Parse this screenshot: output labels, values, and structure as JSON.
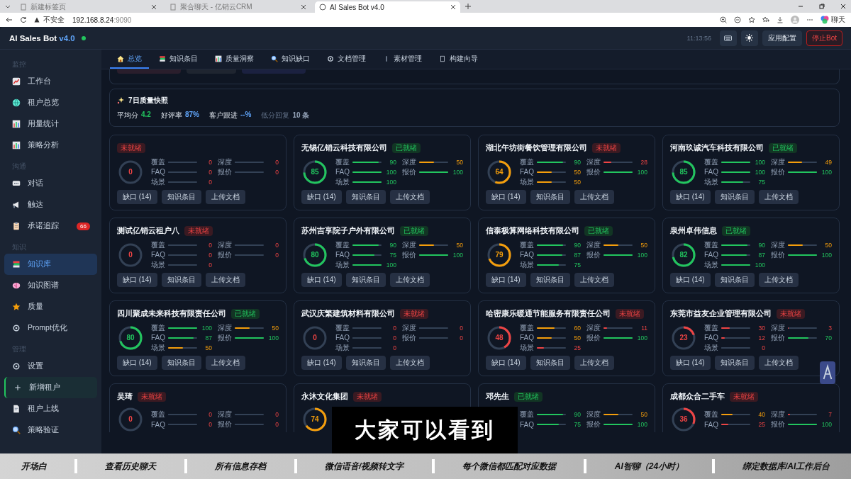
{
  "browser": {
    "tabs": [
      {
        "title": "新建标签页",
        "selected": false
      },
      {
        "title": "聚合聊天 - 亿销云CRM",
        "selected": false
      },
      {
        "title": "AI Sales Bot v4.0",
        "selected": true
      }
    ],
    "security": "不安全",
    "host": "192.168.8.24",
    "port": ":9090",
    "assistant": "聊天"
  },
  "app": {
    "title": "AI Sales Bot",
    "version": "v4.0",
    "online": true,
    "time": "11:13:56",
    "buttons": [
      {
        "label": "应用配置",
        "kind": "default"
      },
      {
        "label": "停止Bot",
        "kind": "danger"
      }
    ]
  },
  "sidebar": {
    "sections": [
      {
        "title": "监控",
        "items": [
          {
            "label": "工作台",
            "kind": "link",
            "selected": false
          },
          {
            "label": "租户总览",
            "kind": "link",
            "selected": false
          },
          {
            "label": "用量统计",
            "kind": "link",
            "selected": false
          },
          {
            "label": "策略分析",
            "kind": "link",
            "selected": false
          }
        ]
      },
      {
        "title": "沟通",
        "items": [
          {
            "label": "对话",
            "kind": "link",
            "selected": false
          },
          {
            "label": "触达",
            "kind": "link",
            "selected": false
          },
          {
            "label": "承诺追踪",
            "kind": "link",
            "selected": false,
            "badge": "66"
          }
        ]
      },
      {
        "title": "知识",
        "items": [
          {
            "label": "知识库",
            "kind": "link",
            "selected": true
          },
          {
            "label": "知识图谱",
            "kind": "link",
            "selected": false
          },
          {
            "label": "质量",
            "kind": "link",
            "selected": false
          },
          {
            "label": "Prompt优化",
            "kind": "link",
            "selected": false
          }
        ]
      },
      {
        "title": "管理",
        "items": [
          {
            "label": "设置",
            "kind": "link",
            "selected": false
          },
          {
            "label": "新增租户",
            "kind": "action",
            "selected": false
          },
          {
            "label": "租户上线",
            "kind": "link",
            "selected": false
          },
          {
            "label": "策略验证",
            "kind": "link",
            "selected": false
          }
        ]
      }
    ]
  },
  "tabs": [
    {
      "label": "总览",
      "selected": true
    },
    {
      "label": "知识条目",
      "selected": false
    },
    {
      "label": "质量洞察",
      "selected": false
    },
    {
      "label": "知识缺口",
      "selected": false
    },
    {
      "label": "文档管理",
      "selected": false
    },
    {
      "label": "素材管理",
      "selected": false
    },
    {
      "label": "构建向导",
      "selected": false
    }
  ],
  "snapshot": {
    "title": "7日质量快照",
    "stats": [
      {
        "label": "平均分",
        "value": "4.2",
        "color": "#22c55e"
      },
      {
        "label": "好评率",
        "value": "87%",
        "color": "#60a5fa"
      },
      {
        "label": "客户跟进",
        "value": "--%",
        "color": "#60a5fa"
      },
      {
        "label": "低分回复",
        "value": "10 条",
        "color": "#94a3b8"
      }
    ]
  },
  "cards": [
    {
      "status": "未就绪",
      "ready": false,
      "score": "0",
      "level": 0,
      "metrics": [
        {
          "label": "覆盖",
          "value": "0",
          "level": 0
        },
        {
          "label": "深度",
          "value": "0",
          "level": 0
        },
        {
          "label": "FAQ",
          "value": "0",
          "level": 0
        },
        {
          "label": "报价",
          "value": "0",
          "level": 0
        },
        {
          "label": "场景",
          "value": "0",
          "level": 0
        }
      ],
      "buttons": [
        "缺口 (14)",
        "知识条目",
        "上传文档"
      ]
    },
    {
      "title": "无锡亿销云科技有限公司",
      "status": "已就绪",
      "ready": true,
      "score": "85",
      "level": 0.85,
      "metrics": [
        {
          "label": "覆盖",
          "value": "90",
          "level": 0.9
        },
        {
          "label": "深度",
          "value": "50",
          "level": 0.5
        },
        {
          "label": "FAQ",
          "value": "100",
          "level": 1
        },
        {
          "label": "报价",
          "value": "100",
          "level": 1
        },
        {
          "label": "场景",
          "value": "100",
          "level": 1
        }
      ],
      "buttons": [
        "缺口 (14)",
        "知识条目",
        "上传文档"
      ]
    },
    {
      "title": "湖北午坊街餐饮管理有限公司",
      "status": "未就绪",
      "ready": false,
      "score": "64",
      "level": 0.64,
      "metrics": [
        {
          "label": "覆盖",
          "value": "90",
          "level": 0.9
        },
        {
          "label": "深度",
          "value": "28",
          "level": 0.28
        },
        {
          "label": "FAQ",
          "value": "50",
          "level": 0.5
        },
        {
          "label": "报价",
          "value": "100",
          "level": 1
        },
        {
          "label": "场景",
          "value": "50",
          "level": 0.5
        }
      ],
      "buttons": [
        "缺口 (14)",
        "知识条目",
        "上传文档"
      ]
    },
    {
      "title": "河南玖诚汽车科技有限公司",
      "status": "已就绪",
      "ready": true,
      "score": "85",
      "level": 0.85,
      "metrics": [
        {
          "label": "覆盖",
          "value": "100",
          "level": 1
        },
        {
          "label": "深度",
          "value": "49",
          "level": 0.49
        },
        {
          "label": "FAQ",
          "value": "100",
          "level": 1
        },
        {
          "label": "报价",
          "value": "100",
          "level": 1
        },
        {
          "label": "场景",
          "value": "75",
          "level": 0.75
        }
      ],
      "buttons": [
        "缺口 (14)",
        "知识条目",
        "上传文档"
      ]
    },
    {
      "title": "测试亿销云租户八",
      "status": "未就绪",
      "ready": false,
      "score": "0",
      "level": 0,
      "metrics": [
        {
          "label": "覆盖",
          "value": "0",
          "level": 0
        },
        {
          "label": "深度",
          "value": "0",
          "level": 0
        },
        {
          "label": "FAQ",
          "value": "0",
          "level": 0
        },
        {
          "label": "报价",
          "value": "0",
          "level": 0
        },
        {
          "label": "场景",
          "value": "0",
          "level": 0
        }
      ],
      "buttons": [
        "缺口 (14)",
        "知识条目",
        "上传文档"
      ]
    },
    {
      "title": "苏州吉享院子户外有限公司",
      "status": "已就绪",
      "ready": true,
      "score": "80",
      "level": 0.8,
      "metrics": [
        {
          "label": "覆盖",
          "value": "90",
          "level": 0.9
        },
        {
          "label": "深度",
          "value": "50",
          "level": 0.5
        },
        {
          "label": "FAQ",
          "value": "75",
          "level": 0.75
        },
        {
          "label": "报价",
          "value": "100",
          "level": 1
        },
        {
          "label": "场景",
          "value": "100",
          "level": 1
        }
      ],
      "buttons": [
        "缺口 (14)",
        "知识条目",
        "上传文档"
      ]
    },
    {
      "title": "信泰极算网络科技有限公司",
      "status": "已就绪",
      "ready": true,
      "score": "79",
      "level": 0.79,
      "metrics": [
        {
          "label": "覆盖",
          "value": "90",
          "level": 0.9
        },
        {
          "label": "深度",
          "value": "50",
          "level": 0.5
        },
        {
          "label": "FAQ",
          "value": "87",
          "level": 0.87
        },
        {
          "label": "报价",
          "value": "100",
          "level": 1
        },
        {
          "label": "场景",
          "value": "75",
          "level": 0.75
        }
      ],
      "buttons": [
        "缺口 (14)",
        "知识条目",
        "上传文档"
      ]
    },
    {
      "title": "泉州卓伟信息",
      "status": "已就绪",
      "ready": true,
      "score": "82",
      "level": 0.82,
      "metrics": [
        {
          "label": "覆盖",
          "value": "90",
          "level": 0.9
        },
        {
          "label": "深度",
          "value": "50",
          "level": 0.5
        },
        {
          "label": "FAQ",
          "value": "87",
          "level": 0.87
        },
        {
          "label": "报价",
          "value": "100",
          "level": 1
        },
        {
          "label": "场景",
          "value": "100",
          "level": 1
        }
      ],
      "buttons": [
        "缺口 (14)",
        "知识条目",
        "上传文档"
      ]
    },
    {
      "title": "四川聚成未来科技有限责任公司",
      "status": "已就绪",
      "ready": true,
      "score": "80",
      "level": 0.8,
      "metrics": [
        {
          "label": "覆盖",
          "value": "100",
          "level": 1
        },
        {
          "label": "深度",
          "value": "50",
          "level": 0.5
        },
        {
          "label": "FAQ",
          "value": "87",
          "level": 0.87
        },
        {
          "label": "报价",
          "value": "100",
          "level": 1
        },
        {
          "label": "场景",
          "value": "50",
          "level": 0.5
        }
      ],
      "buttons": [
        "缺口 (14)",
        "知识条目",
        "上传文档"
      ]
    },
    {
      "title": "武汉庆繁建筑材料有限公司",
      "status": "未就绪",
      "ready": false,
      "score": "0",
      "level": 0,
      "metrics": [
        {
          "label": "覆盖",
          "value": "0",
          "level": 0
        },
        {
          "label": "深度",
          "value": "0",
          "level": 0
        },
        {
          "label": "FAQ",
          "value": "0",
          "level": 0
        },
        {
          "label": "报价",
          "value": "0",
          "level": 0
        },
        {
          "label": "场景",
          "value": "0",
          "level": 0
        }
      ],
      "buttons": [
        "缺口 (14)",
        "知识条目",
        "上传文档"
      ]
    },
    {
      "title": "哈密康乐暖通节能服务有限责任公司",
      "status": "未就绪",
      "ready": false,
      "score": "48",
      "level": 0.48,
      "metrics": [
        {
          "label": "覆盖",
          "value": "60",
          "level": 0.6
        },
        {
          "label": "深度",
          "value": "11",
          "level": 0.11
        },
        {
          "label": "FAQ",
          "value": "50",
          "level": 0.5
        },
        {
          "label": "报价",
          "value": "100",
          "level": 1
        },
        {
          "label": "场景",
          "value": "25",
          "level": 0.25
        }
      ],
      "buttons": [
        "缺口 (14)",
        "知识条目",
        "上传文档"
      ]
    },
    {
      "title": "东莞市益友企业管理有限公司",
      "status": "未就绪",
      "ready": false,
      "score": "23",
      "level": 0.23,
      "metrics": [
        {
          "label": "覆盖",
          "value": "30",
          "level": 0.3
        },
        {
          "label": "深度",
          "value": "3",
          "level": 0.03
        },
        {
          "label": "FAQ",
          "value": "12",
          "level": 0.12
        },
        {
          "label": "报价",
          "value": "70",
          "level": 0.7
        },
        {
          "label": "场景",
          "value": "0",
          "level": 0
        }
      ],
      "buttons": [
        "缺口 (14)",
        "知识条目",
        "上传文档"
      ]
    },
    {
      "title": "吴琦",
      "status": "未就绪",
      "ready": false,
      "score": "0",
      "level": 0,
      "metrics": [
        {
          "label": "覆盖",
          "value": "0",
          "level": 0
        },
        {
          "label": "深度",
          "value": "0",
          "level": 0
        },
        {
          "label": "FAQ",
          "value": "0",
          "level": 0
        },
        {
          "label": "报价",
          "value": "0",
          "level": 0
        }
      ]
    },
    {
      "title": "永沐文化集团",
      "status": "未就绪",
      "ready": false,
      "score": "74",
      "level": 0.74
    },
    {
      "title": "邓先生",
      "status": "已就绪",
      "ready": true,
      "metrics": [
        {
          "label": "覆盖",
          "value": "90",
          "level": 0.9
        },
        {
          "label": "深度",
          "value": "50",
          "level": 0.5
        },
        {
          "label": "FAQ",
          "value": "75",
          "level": 0.75
        },
        {
          "label": "报价",
          "value": "100",
          "level": 1
        }
      ]
    },
    {
      "title": "成都众合二手车",
      "status": "未就绪",
      "ready": false,
      "score": "36",
      "level": 0.36,
      "metrics": [
        {
          "label": "覆盖",
          "value": "40",
          "level": 0.4
        },
        {
          "label": "深度",
          "value": "7",
          "level": 0.07
        },
        {
          "label": "FAQ",
          "value": "25",
          "level": 0.25
        },
        {
          "label": "报价",
          "value": "100",
          "level": 1
        }
      ]
    }
  ],
  "overlay": {
    "subtitle": "大家可以看到",
    "banner": [
      "开场白",
      "查看历史聊天",
      "所有信息存档",
      "微信语音/视频转文字",
      "每个微信都匹配对应数据",
      "AI智聊（24小时）",
      "绑定数据库/AI工作后台"
    ]
  }
}
